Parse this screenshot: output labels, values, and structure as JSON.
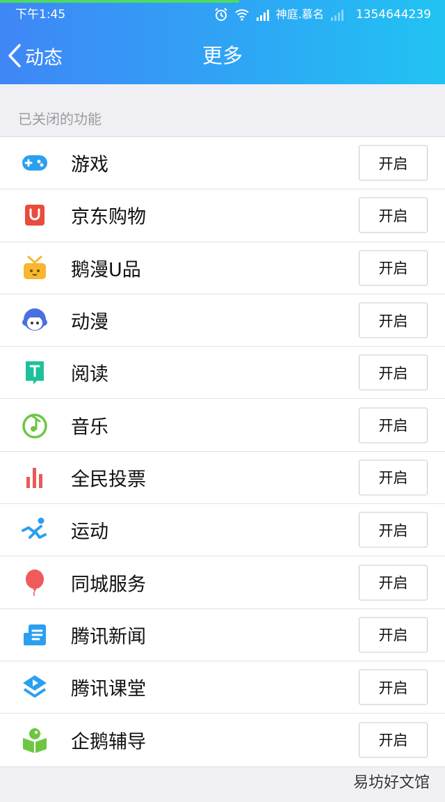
{
  "status_bar": {
    "time": "下午1:45",
    "carrier": "神庭.慕名",
    "phone": "1354644239"
  },
  "nav": {
    "back_label": "动态",
    "title": "更多"
  },
  "section": {
    "label": "已关闭的功能"
  },
  "features": [
    {
      "name": "游戏",
      "button": "开启",
      "icon": "gamepad-icon",
      "color": "#2b9ff0"
    },
    {
      "name": "京东购物",
      "button": "开启",
      "icon": "jd-bag-icon",
      "color": "#e84c3d"
    },
    {
      "name": "鹅漫U品",
      "button": "开启",
      "icon": "gift-box-icon",
      "color": "#f7b731"
    },
    {
      "name": "动漫",
      "button": "开启",
      "icon": "anime-face-icon",
      "color": "#4a6fe0"
    },
    {
      "name": "阅读",
      "button": "开启",
      "icon": "book-icon",
      "color": "#1fc19a"
    },
    {
      "name": "音乐",
      "button": "开启",
      "icon": "music-note-icon",
      "color": "#6cc644"
    },
    {
      "name": "全民投票",
      "button": "开启",
      "icon": "bar-chart-icon",
      "color": "#e85a5a"
    },
    {
      "name": "运动",
      "button": "开启",
      "icon": "runner-icon",
      "color": "#2b9ff0"
    },
    {
      "name": "同城服务",
      "button": "开启",
      "icon": "balloon-icon",
      "color": "#f05a5a"
    },
    {
      "name": "腾讯新闻",
      "button": "开启",
      "icon": "newspaper-icon",
      "color": "#2b9ff0"
    },
    {
      "name": "腾讯课堂",
      "button": "开启",
      "icon": "classroom-play-icon",
      "color": "#2b9ff0"
    },
    {
      "name": "企鹅辅导",
      "button": "开启",
      "icon": "penguin-book-icon",
      "color": "#6cc644"
    }
  ],
  "watermark": "易坊好文馆"
}
